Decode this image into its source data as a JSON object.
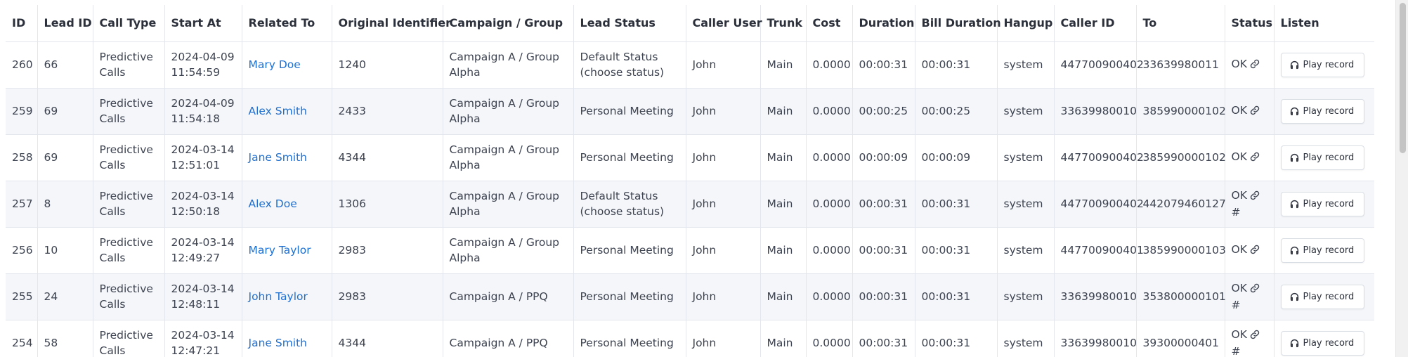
{
  "columns": [
    "ID",
    "Lead ID",
    "Call Type",
    "Start At",
    "Related To",
    "Original Identifier",
    "Campaign / Group",
    "Lead Status",
    "Caller User",
    "Trunk",
    "Cost",
    "Duration",
    "Bill Duration",
    "Hangup",
    "Caller ID",
    "To",
    "Status",
    "Listen"
  ],
  "play_label": "Play record",
  "rows": [
    {
      "id": "260",
      "lead_id": "66",
      "call_type": "Predictive Calls",
      "start_at": "2024-04-09 11:54:59",
      "related_to": "Mary Doe",
      "original_identifier": "1240",
      "campaign_group": "Campaign A / Group Alpha",
      "lead_status": "Default Status (choose status)",
      "caller_user": "John",
      "trunk": "Main",
      "cost": "0.0000",
      "duration": "00:00:31",
      "bill_duration": "00:00:31",
      "hangup": "system",
      "caller_id": "447700900402",
      "to": "33639980011",
      "status": "OK",
      "status_extra": ""
    },
    {
      "id": "259",
      "lead_id": "69",
      "call_type": "Predictive Calls",
      "start_at": "2024-04-09 11:54:18",
      "related_to": "Alex Smith",
      "original_identifier": "2433",
      "campaign_group": "Campaign A / Group Alpha",
      "lead_status": "Personal Meeting",
      "caller_user": "John",
      "trunk": "Main",
      "cost": "0.0000",
      "duration": "00:00:25",
      "bill_duration": "00:00:25",
      "hangup": "system",
      "caller_id": "33639980010",
      "to": "385990000102",
      "status": "OK",
      "status_extra": ""
    },
    {
      "id": "258",
      "lead_id": "69",
      "call_type": "Predictive Calls",
      "start_at": "2024-03-14 12:51:01",
      "related_to": "Jane Smith",
      "original_identifier": "4344",
      "campaign_group": "Campaign A / Group Alpha",
      "lead_status": "Personal Meeting",
      "caller_user": "John",
      "trunk": "Main",
      "cost": "0.0000",
      "duration": "00:00:09",
      "bill_duration": "00:00:09",
      "hangup": "system",
      "caller_id": "447700900402",
      "to": "385990000102",
      "status": "OK",
      "status_extra": ""
    },
    {
      "id": "257",
      "lead_id": "8",
      "call_type": "Predictive Calls",
      "start_at": "2024-03-14 12:50:18",
      "related_to": "Alex Doe",
      "original_identifier": "1306",
      "campaign_group": "Campaign A / Group Alpha",
      "lead_status": "Default Status (choose status)",
      "caller_user": "John",
      "trunk": "Main",
      "cost": "0.0000",
      "duration": "00:00:31",
      "bill_duration": "00:00:31",
      "hangup": "system",
      "caller_id": "447700900402",
      "to": "442079460127",
      "status": "OK",
      "status_extra": "#"
    },
    {
      "id": "256",
      "lead_id": "10",
      "call_type": "Predictive Calls",
      "start_at": "2024-03-14 12:49:27",
      "related_to": "Mary Taylor",
      "original_identifier": "2983",
      "campaign_group": "Campaign A / Group Alpha",
      "lead_status": "Personal Meeting",
      "caller_user": "John",
      "trunk": "Main",
      "cost": "0.0000",
      "duration": "00:00:31",
      "bill_duration": "00:00:31",
      "hangup": "system",
      "caller_id": "447700900401",
      "to": "385990000103",
      "status": "OK",
      "status_extra": ""
    },
    {
      "id": "255",
      "lead_id": "24",
      "call_type": "Predictive Calls",
      "start_at": "2024-03-14 12:48:11",
      "related_to": "John Taylor",
      "original_identifier": "2983",
      "campaign_group": "Campaign A / PPQ",
      "lead_status": "Personal Meeting",
      "caller_user": "John",
      "trunk": "Main",
      "cost": "0.0000",
      "duration": "00:00:31",
      "bill_duration": "00:00:31",
      "hangup": "system",
      "caller_id": "33639980010",
      "to": "353800000101",
      "status": "OK",
      "status_extra": "#"
    },
    {
      "id": "254",
      "lead_id": "58",
      "call_type": "Predictive Calls",
      "start_at": "2024-03-14 12:47:21",
      "related_to": "Jane Smith",
      "original_identifier": "4344",
      "campaign_group": "Campaign A / PPQ",
      "lead_status": "Personal Meeting",
      "caller_user": "John",
      "trunk": "Main",
      "cost": "0.0000",
      "duration": "00:00:31",
      "bill_duration": "00:00:31",
      "hangup": "system",
      "caller_id": "33639980010",
      "to": "39300000401",
      "status": "OK",
      "status_extra": "#"
    }
  ],
  "colors": {
    "link": "#1d6fd1",
    "stripe": "#f4f6f9",
    "border": "#e3e6ec"
  },
  "icons": {
    "status_link": "link-icon",
    "play": "headphones-icon"
  }
}
